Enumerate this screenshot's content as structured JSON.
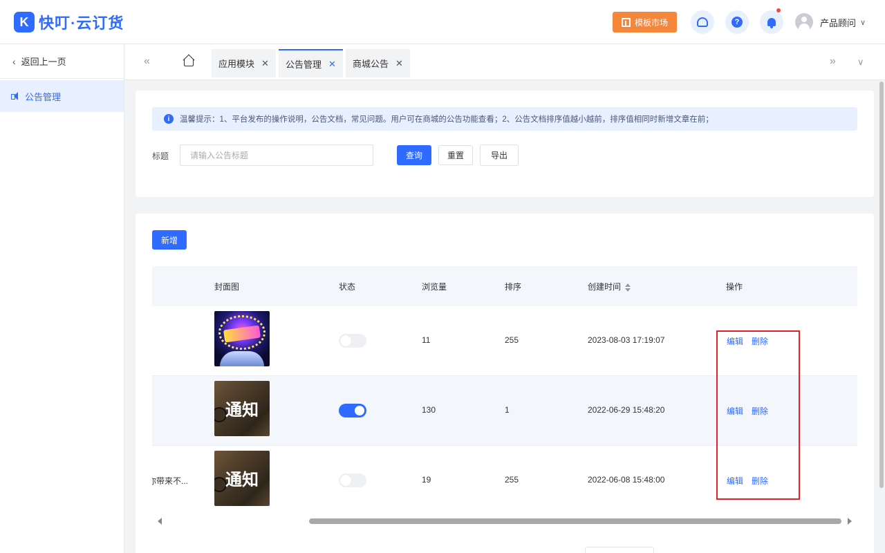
{
  "app": {
    "logo_mark": "K",
    "title": "快叮·云订货"
  },
  "header": {
    "market_button": "模板市场",
    "user_name": "产品顾问"
  },
  "sidebar": {
    "back_label": "返回上一页",
    "items": [
      {
        "label": "公告管理",
        "active": true
      }
    ]
  },
  "tabs": [
    {
      "label": "应用模块",
      "active": false
    },
    {
      "label": "公告管理",
      "active": true
    },
    {
      "label": "商城公告",
      "active": false
    }
  ],
  "notice": {
    "text": "温馨提示：1、平台发布的操作说明，公告文档，常见问题。用户可在商城的公告功能查看；2、公告文档排序值越小越前，排序值相同时新增文章在前；"
  },
  "filter": {
    "title_label": "标题",
    "title_placeholder": "请输入公告标题",
    "query_button": "查询",
    "reset_button": "重置",
    "export_button": "导出"
  },
  "table": {
    "add_button": "新增",
    "columns": {
      "cover": "封面图",
      "status": "状态",
      "views": "浏览量",
      "sort": "排序",
      "created": "创建时间",
      "actions": "操作"
    },
    "rows": [
      {
        "title": "",
        "cover": "party-image",
        "status": "off",
        "views": "11",
        "sort": "255",
        "created": "2023-08-03 17:19:07",
        "edit": "编辑",
        "delete": "删除",
        "cover_text": ""
      },
      {
        "title": "",
        "cover": "notice-image",
        "status": "on",
        "views": "130",
        "sort": "1",
        "created": "2022-06-29 15:48:20",
        "edit": "编辑",
        "delete": "删除",
        "cover_text": "通知"
      },
      {
        "title": "你带来不...",
        "cover": "notice-image",
        "status": "off",
        "views": "19",
        "sort": "255",
        "created": "2022-06-08 15:48:00",
        "edit": "编辑",
        "delete": "删除",
        "cover_text": "通知"
      }
    ]
  },
  "colors": {
    "primary": "#2f6bff",
    "accent": "#f5873d",
    "highlight": "#e4202a"
  }
}
